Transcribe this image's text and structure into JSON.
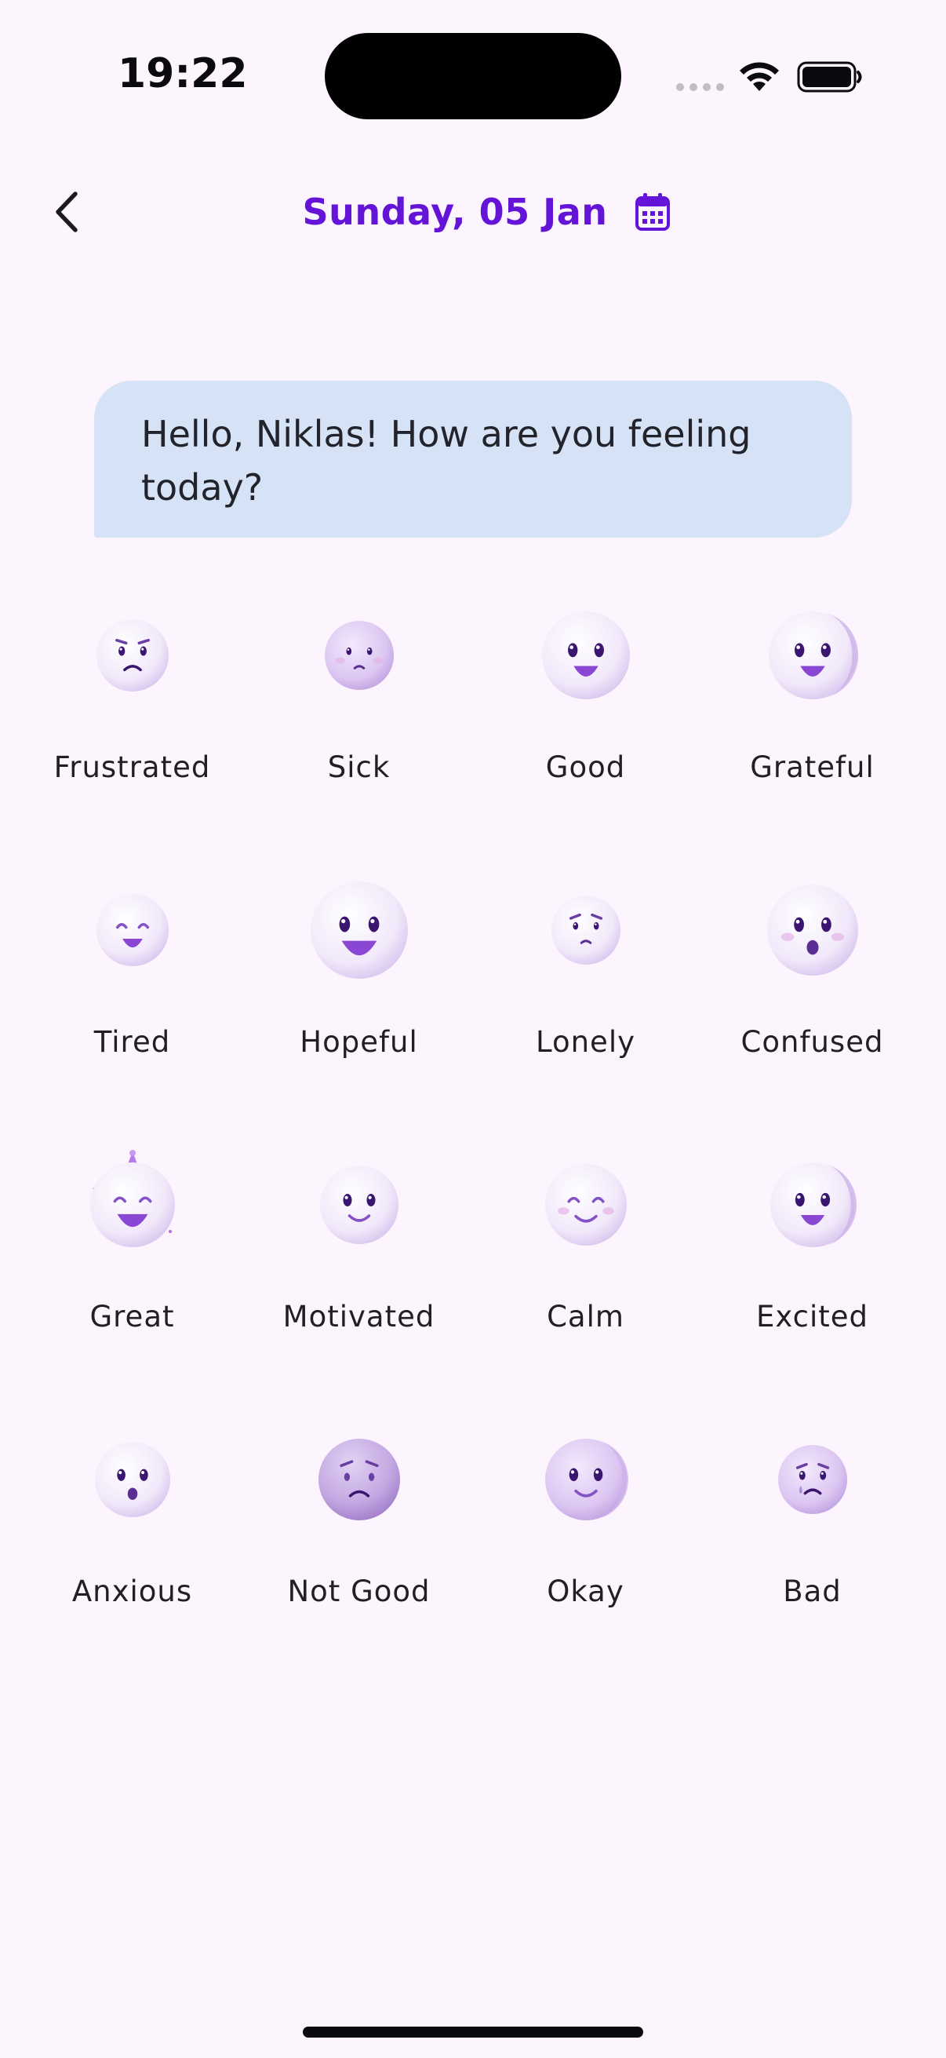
{
  "status_bar": {
    "time": "19:22"
  },
  "header": {
    "back_icon": "chevron-left-icon",
    "date_title": "Sunday, 05 Jan",
    "calendar_icon": "calendar-icon",
    "accent_color": "#6314D6"
  },
  "greeting": {
    "text": "Hello, Niklas! How are you feeling today?",
    "bubble_color": "#D6E2F5"
  },
  "moods": [
    {
      "label": "Frustrated",
      "icon": "frustrated-face-icon"
    },
    {
      "label": "Sick",
      "icon": "sick-face-icon"
    },
    {
      "label": "Good",
      "icon": "good-face-icon"
    },
    {
      "label": "Grateful",
      "icon": "grateful-face-icon"
    },
    {
      "label": "Tired",
      "icon": "tired-face-icon"
    },
    {
      "label": "Hopeful",
      "icon": "hopeful-face-icon"
    },
    {
      "label": "Lonely",
      "icon": "lonely-face-icon"
    },
    {
      "label": "Confused",
      "icon": "confused-face-icon"
    },
    {
      "label": "Great",
      "icon": "party-face-icon"
    },
    {
      "label": "Motivated",
      "icon": "motivated-face-icon"
    },
    {
      "label": "Calm",
      "icon": "calm-face-icon"
    },
    {
      "label": "Excited",
      "icon": "excited-face-icon"
    },
    {
      "label": "Anxious",
      "icon": "anxious-face-icon"
    },
    {
      "label": "Not Good",
      "icon": "not-good-face-icon"
    },
    {
      "label": "Okay",
      "icon": "okay-face-icon"
    },
    {
      "label": "Bad",
      "icon": "bad-face-icon"
    }
  ]
}
